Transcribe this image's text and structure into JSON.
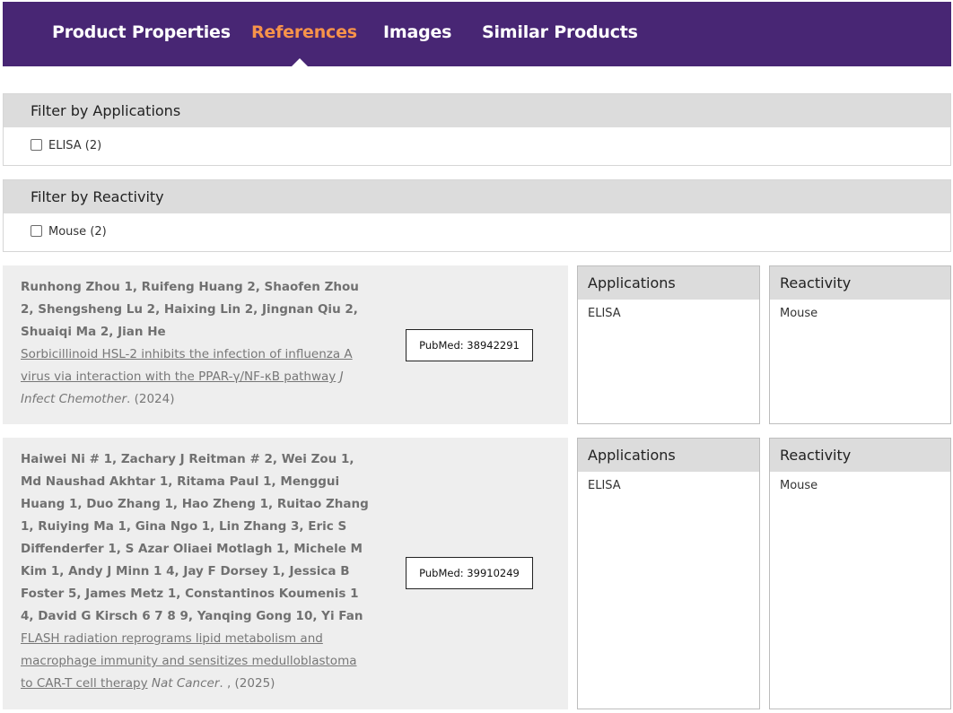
{
  "tabs": [
    {
      "label": "Product Properties",
      "active": false
    },
    {
      "label": "References",
      "active": true
    },
    {
      "label": "Images",
      "active": false
    },
    {
      "label": "Similar Products",
      "active": false
    }
  ],
  "filters": [
    {
      "title": "Filter by Applications",
      "option": "ELISA (2)"
    },
    {
      "title": "Filter by Reactivity",
      "option": "Mouse (2)"
    }
  ],
  "references": [
    {
      "authors": "Runhong Zhou 1, Ruifeng Huang 2, Shaofen Zhou 2, Shengsheng Lu 2, Haixing Lin 2, Jingnan Qiu 2, Shuaiqi Ma 2, Jian He",
      "title": "Sorbicillinoid HSL-2 inhibits the infection of influenza A virus via interaction with the PPAR-γ/NF-κB pathway",
      "journal": "J Infect Chemother",
      "year": ". (2024)",
      "pubmed": "PubMed: 38942291",
      "applications_header": "Applications",
      "applications": "ELISA",
      "reactivity_header": "Reactivity",
      "reactivity": "Mouse"
    },
    {
      "authors": "Haiwei Ni # 1, Zachary J Reitman # 2, Wei Zou 1, Md Naushad Akhtar 1, Ritama Paul 1, Menggui Huang 1, Duo Zhang 1, Hao Zheng 1, Ruitao Zhang 1, Ruiying Ma 1, Gina Ngo 1, Lin Zhang 3, Eric S Diffenderfer 1, S Azar Oliaei Motlagh 1, Michele M Kim 1, Andy J Minn 1 4, Jay F Dorsey 1, Jessica B Foster 5, James Metz 1, Constantinos Koumenis 1 4, David G Kirsch 6 7 8 9, Yanqing Gong 10, Yi Fan",
      "title": "FLASH radiation reprograms lipid metabolism and macrophage immunity and sensitizes medulloblastoma to CAR-T cell therapy",
      "journal": "Nat Cancer",
      "year": ". , (2025)",
      "pubmed": "PubMed: 39910249",
      "applications_header": "Applications",
      "applications": "ELISA",
      "reactivity_header": "Reactivity",
      "reactivity": "Mouse"
    }
  ]
}
